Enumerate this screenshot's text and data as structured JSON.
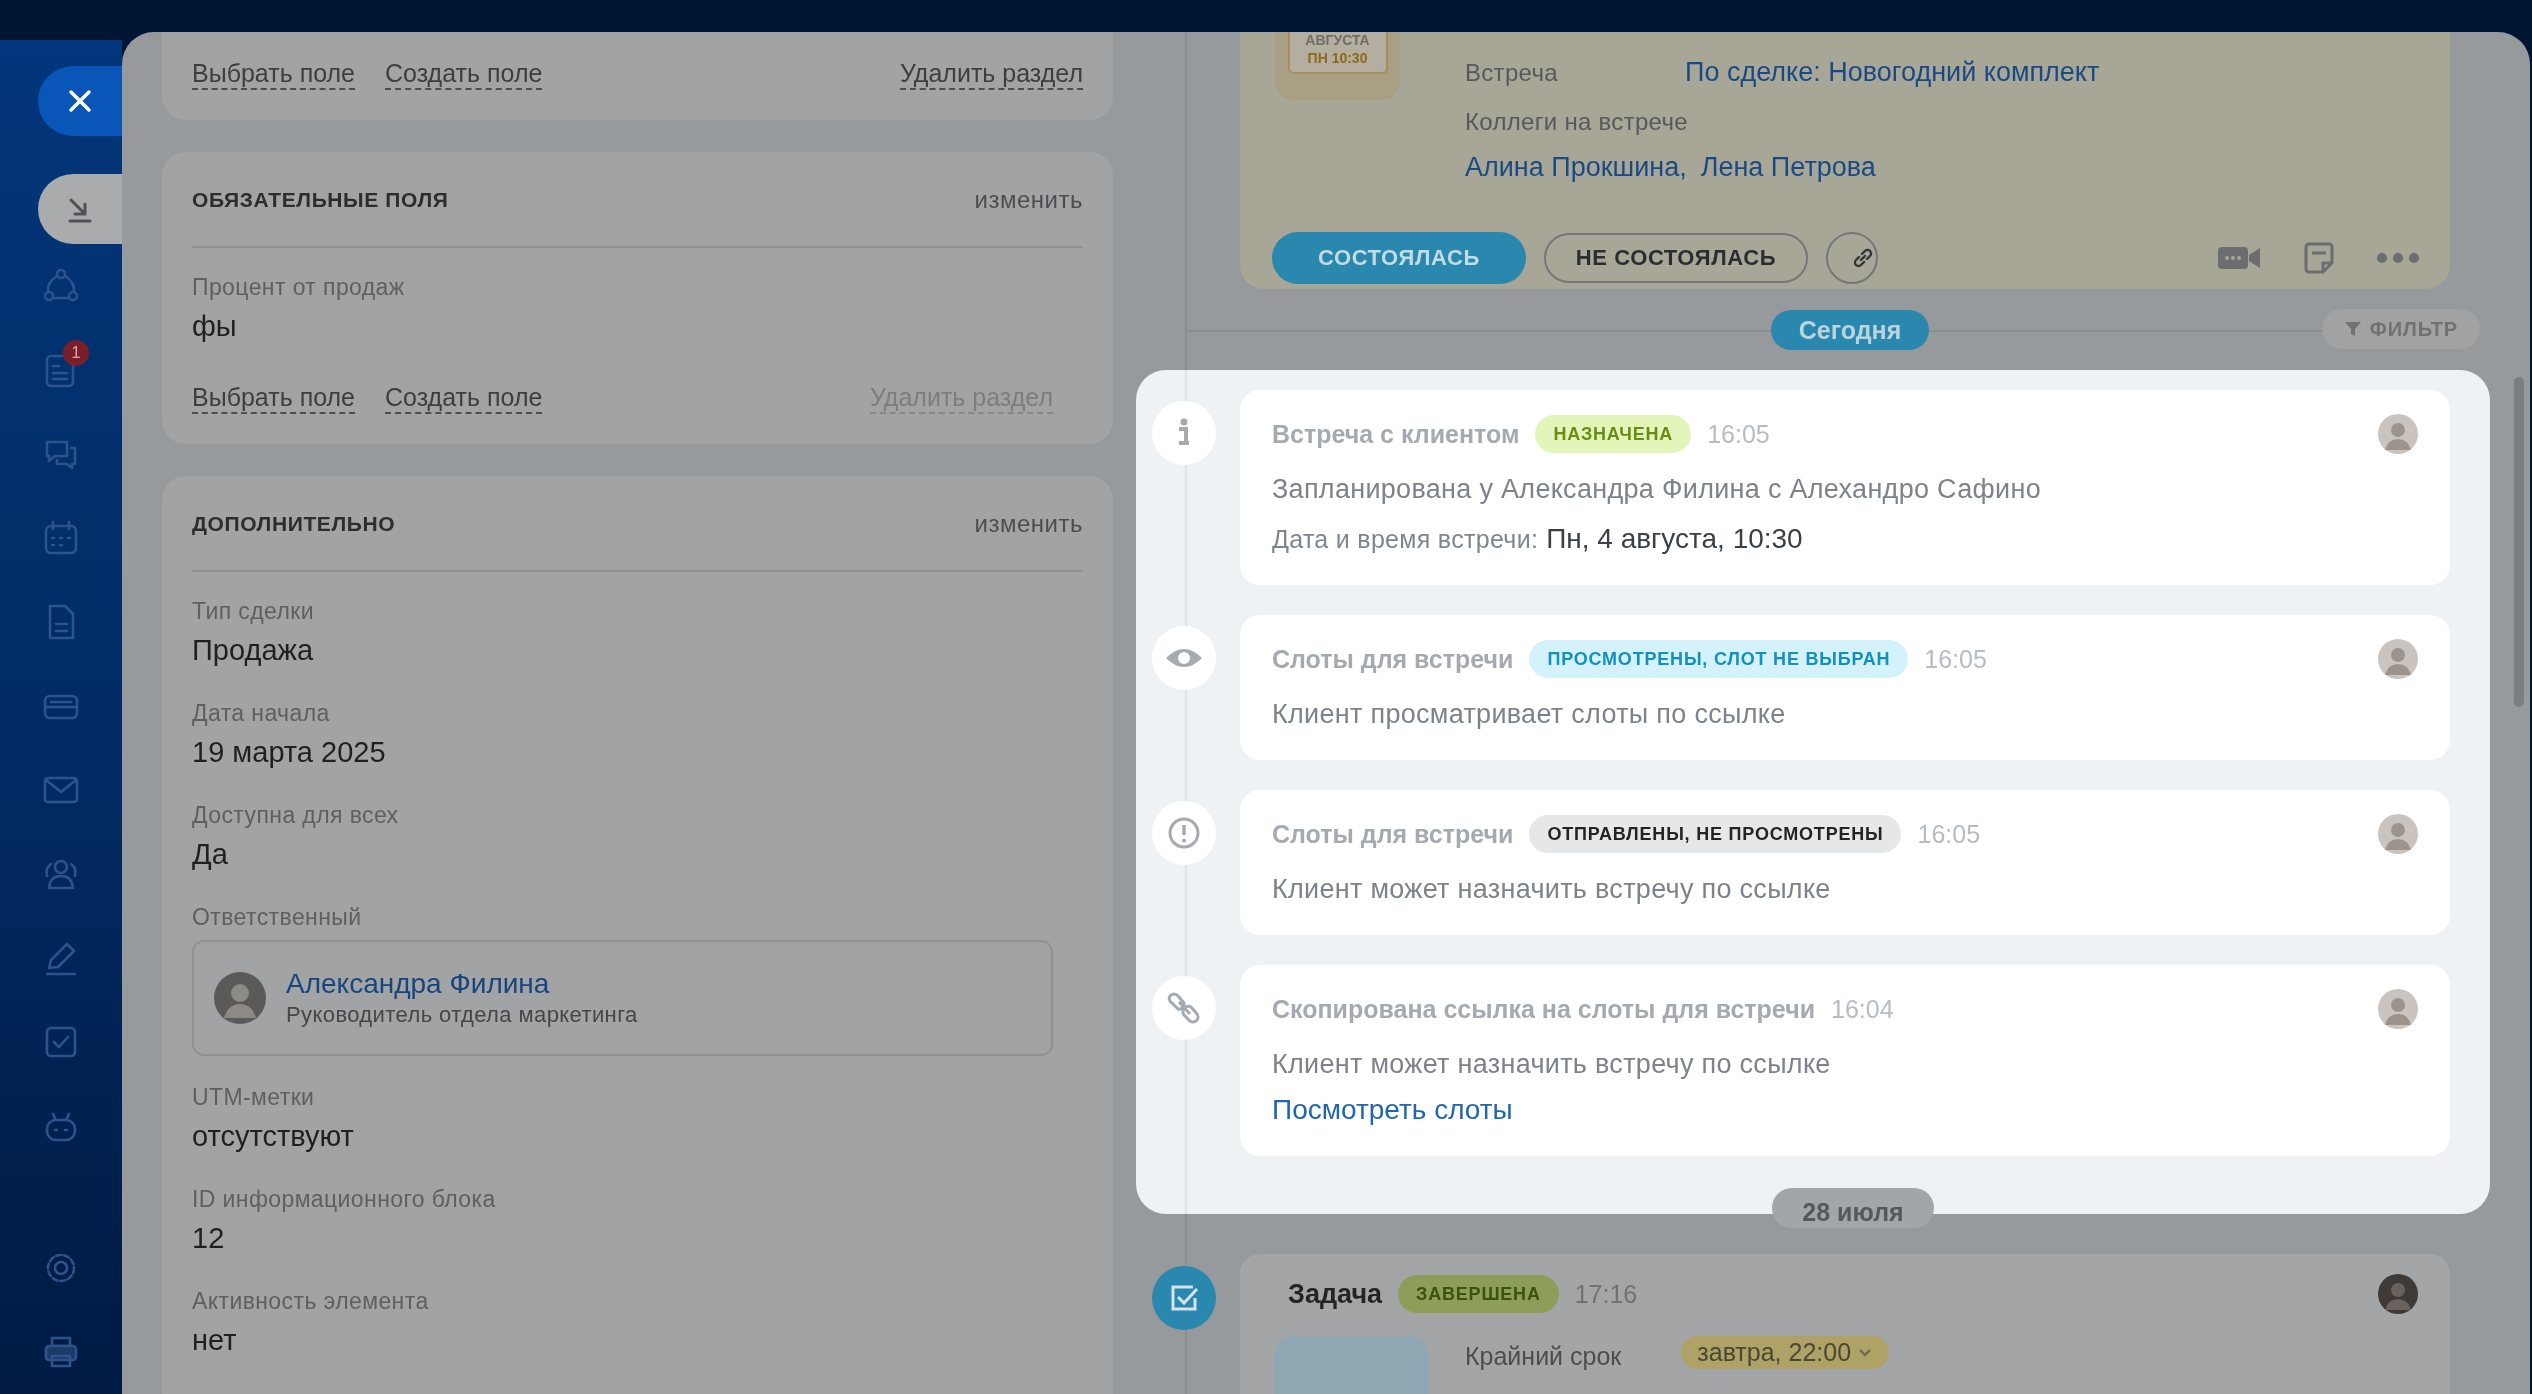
{
  "sidebar": {
    "badge": "1"
  },
  "left_sections": [
    {
      "links": [
        {
          "label": "Выбрать поле",
          "disabled": false
        },
        {
          "label": "Создать поле",
          "disabled": false
        },
        {
          "label": "Удалить раздел",
          "disabled": false
        }
      ]
    },
    {
      "title": "ОБЯЗАТЕЛЬНЫЕ ПОЛЯ",
      "action": "изменить",
      "fields": [
        {
          "kind": "text",
          "label": "Процент от продаж",
          "value": "фы"
        }
      ],
      "links": [
        {
          "label": "Выбрать поле",
          "disabled": false
        },
        {
          "label": "Создать поле",
          "disabled": false
        },
        {
          "label": "Удалить раздел",
          "disabled": true
        }
      ]
    },
    {
      "title": "ДОПОЛНИТЕЛЬНО",
      "action": "изменить",
      "fields": [
        {
          "kind": "text",
          "label": "Тип сделки",
          "value": "Продажа"
        },
        {
          "kind": "text",
          "label": "Дата начала",
          "value": "19 марта 2025"
        },
        {
          "kind": "text",
          "label": "Доступна для всех",
          "value": "Да"
        },
        {
          "kind": "person",
          "label": "Ответственный",
          "name": "Александра Филина",
          "position": "Руководитель отдела маркетинга"
        },
        {
          "kind": "text",
          "label": "UTM-метки",
          "value": "отсутствуют"
        },
        {
          "kind": "text",
          "label": "ID информационного блока",
          "value": "12"
        },
        {
          "kind": "text",
          "label": "Активность элемента",
          "value": "нет"
        }
      ]
    }
  ],
  "meeting_card": {
    "calendar_month": "АВГУСТА",
    "calendar_time": "ПН 10:30",
    "meeting_label": "Встреча",
    "meeting_value": "По сделке: Новогодний комплект",
    "colleagues_label": "Коллеги на встрече",
    "colleagues": [
      "Алина Прокшина,",
      "Лена Петрова"
    ],
    "buttons": [
      {
        "label": "СОСТОЯЛАСЬ",
        "kind": "primary"
      },
      {
        "label": "НЕ СОСТОЯЛАСЬ",
        "kind": "outline"
      }
    ]
  },
  "today_divider": "Сегодня",
  "filter_button": "ФИЛЬТР",
  "timeline": [
    {
      "kind": "info",
      "title": "Встреча с клиентом",
      "status": {
        "label": "НАЗНАЧЕНА",
        "kind": "green"
      },
      "time": "16:05",
      "text": "Запланирована у Александра Филина с Алехандро Сафино",
      "detail_label": "Дата и время встречи:",
      "detail_value": "Пн, 4 августа, 10:30"
    },
    {
      "kind": "eye",
      "title": "Слоты для встречи",
      "status": {
        "label": "ПРОСМОТРЕНЫ, СЛОТ НЕ ВЫБРАН",
        "kind": "blue"
      },
      "time": "16:05",
      "text": "Клиент просматривает слоты по ссылке"
    },
    {
      "kind": "alert",
      "title": "Слоты для встречи",
      "status": {
        "label": "ОТПРАВЛЕНЫ, НЕ ПРОСМОТРЕНЫ",
        "kind": "gray"
      },
      "time": "16:05",
      "text": "Клиент может назначить встречу по ссылке"
    },
    {
      "kind": "link",
      "title": "Скопирована ссылка на слоты для встречи",
      "time": "16:04",
      "text": "Клиент может назначить встречу по ссылке",
      "link": "Посмотреть слоты"
    }
  ],
  "date_divider": "28 июля",
  "task": {
    "title": "Задача",
    "status": "ЗАВЕРШЕНА",
    "time": "17:16",
    "deadline_label": "Крайний срок",
    "deadline_value": "завтра, 22:00"
  }
}
